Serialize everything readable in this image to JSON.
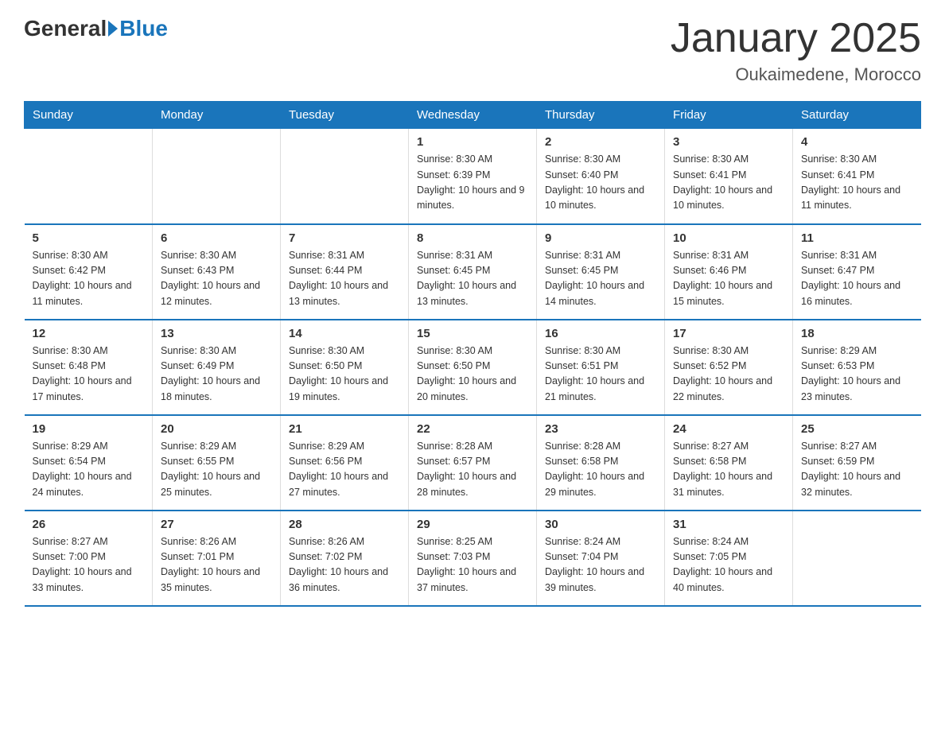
{
  "header": {
    "logo_general": "General",
    "logo_blue": "Blue",
    "title": "January 2025",
    "subtitle": "Oukaimedene, Morocco"
  },
  "days_of_week": [
    "Sunday",
    "Monday",
    "Tuesday",
    "Wednesday",
    "Thursday",
    "Friday",
    "Saturday"
  ],
  "weeks": [
    [
      {
        "day": "",
        "info": ""
      },
      {
        "day": "",
        "info": ""
      },
      {
        "day": "",
        "info": ""
      },
      {
        "day": "1",
        "info": "Sunrise: 8:30 AM\nSunset: 6:39 PM\nDaylight: 10 hours\nand 9 minutes."
      },
      {
        "day": "2",
        "info": "Sunrise: 8:30 AM\nSunset: 6:40 PM\nDaylight: 10 hours\nand 10 minutes."
      },
      {
        "day": "3",
        "info": "Sunrise: 8:30 AM\nSunset: 6:41 PM\nDaylight: 10 hours\nand 10 minutes."
      },
      {
        "day": "4",
        "info": "Sunrise: 8:30 AM\nSunset: 6:41 PM\nDaylight: 10 hours\nand 11 minutes."
      }
    ],
    [
      {
        "day": "5",
        "info": "Sunrise: 8:30 AM\nSunset: 6:42 PM\nDaylight: 10 hours\nand 11 minutes."
      },
      {
        "day": "6",
        "info": "Sunrise: 8:30 AM\nSunset: 6:43 PM\nDaylight: 10 hours\nand 12 minutes."
      },
      {
        "day": "7",
        "info": "Sunrise: 8:31 AM\nSunset: 6:44 PM\nDaylight: 10 hours\nand 13 minutes."
      },
      {
        "day": "8",
        "info": "Sunrise: 8:31 AM\nSunset: 6:45 PM\nDaylight: 10 hours\nand 13 minutes."
      },
      {
        "day": "9",
        "info": "Sunrise: 8:31 AM\nSunset: 6:45 PM\nDaylight: 10 hours\nand 14 minutes."
      },
      {
        "day": "10",
        "info": "Sunrise: 8:31 AM\nSunset: 6:46 PM\nDaylight: 10 hours\nand 15 minutes."
      },
      {
        "day": "11",
        "info": "Sunrise: 8:31 AM\nSunset: 6:47 PM\nDaylight: 10 hours\nand 16 minutes."
      }
    ],
    [
      {
        "day": "12",
        "info": "Sunrise: 8:30 AM\nSunset: 6:48 PM\nDaylight: 10 hours\nand 17 minutes."
      },
      {
        "day": "13",
        "info": "Sunrise: 8:30 AM\nSunset: 6:49 PM\nDaylight: 10 hours\nand 18 minutes."
      },
      {
        "day": "14",
        "info": "Sunrise: 8:30 AM\nSunset: 6:50 PM\nDaylight: 10 hours\nand 19 minutes."
      },
      {
        "day": "15",
        "info": "Sunrise: 8:30 AM\nSunset: 6:50 PM\nDaylight: 10 hours\nand 20 minutes."
      },
      {
        "day": "16",
        "info": "Sunrise: 8:30 AM\nSunset: 6:51 PM\nDaylight: 10 hours\nand 21 minutes."
      },
      {
        "day": "17",
        "info": "Sunrise: 8:30 AM\nSunset: 6:52 PM\nDaylight: 10 hours\nand 22 minutes."
      },
      {
        "day": "18",
        "info": "Sunrise: 8:29 AM\nSunset: 6:53 PM\nDaylight: 10 hours\nand 23 minutes."
      }
    ],
    [
      {
        "day": "19",
        "info": "Sunrise: 8:29 AM\nSunset: 6:54 PM\nDaylight: 10 hours\nand 24 minutes."
      },
      {
        "day": "20",
        "info": "Sunrise: 8:29 AM\nSunset: 6:55 PM\nDaylight: 10 hours\nand 25 minutes."
      },
      {
        "day": "21",
        "info": "Sunrise: 8:29 AM\nSunset: 6:56 PM\nDaylight: 10 hours\nand 27 minutes."
      },
      {
        "day": "22",
        "info": "Sunrise: 8:28 AM\nSunset: 6:57 PM\nDaylight: 10 hours\nand 28 minutes."
      },
      {
        "day": "23",
        "info": "Sunrise: 8:28 AM\nSunset: 6:58 PM\nDaylight: 10 hours\nand 29 minutes."
      },
      {
        "day": "24",
        "info": "Sunrise: 8:27 AM\nSunset: 6:58 PM\nDaylight: 10 hours\nand 31 minutes."
      },
      {
        "day": "25",
        "info": "Sunrise: 8:27 AM\nSunset: 6:59 PM\nDaylight: 10 hours\nand 32 minutes."
      }
    ],
    [
      {
        "day": "26",
        "info": "Sunrise: 8:27 AM\nSunset: 7:00 PM\nDaylight: 10 hours\nand 33 minutes."
      },
      {
        "day": "27",
        "info": "Sunrise: 8:26 AM\nSunset: 7:01 PM\nDaylight: 10 hours\nand 35 minutes."
      },
      {
        "day": "28",
        "info": "Sunrise: 8:26 AM\nSunset: 7:02 PM\nDaylight: 10 hours\nand 36 minutes."
      },
      {
        "day": "29",
        "info": "Sunrise: 8:25 AM\nSunset: 7:03 PM\nDaylight: 10 hours\nand 37 minutes."
      },
      {
        "day": "30",
        "info": "Sunrise: 8:24 AM\nSunset: 7:04 PM\nDaylight: 10 hours\nand 39 minutes."
      },
      {
        "day": "31",
        "info": "Sunrise: 8:24 AM\nSunset: 7:05 PM\nDaylight: 10 hours\nand 40 minutes."
      },
      {
        "day": "",
        "info": ""
      }
    ]
  ]
}
